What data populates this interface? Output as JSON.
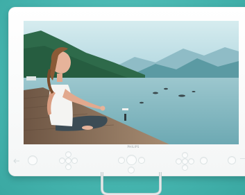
{
  "device": {
    "brand_label": "PHILIPS",
    "control_icons": [
      "back-arrow-icon",
      "power-button-icon",
      "dpad-left-icon",
      "dpad-center-icon",
      "dpad-right-icon",
      "dpad-up-icon",
      "dpad-down-icon",
      "menu-button-icon",
      "volume-button-icon",
      "settings-button-icon"
    ]
  },
  "screen_image": {
    "subject": "woman-meditating-on-dock-icon",
    "colors": {
      "sky": "#b7dbe3",
      "mountains": "#4a8f98",
      "lake": "#7eb7c0",
      "dock": "#8a6f57",
      "trees": "#2f6f4c"
    }
  },
  "colors": {
    "background": "#4cbcb6",
    "bezel": "#ffffff",
    "stand": "#cfd6d8"
  }
}
